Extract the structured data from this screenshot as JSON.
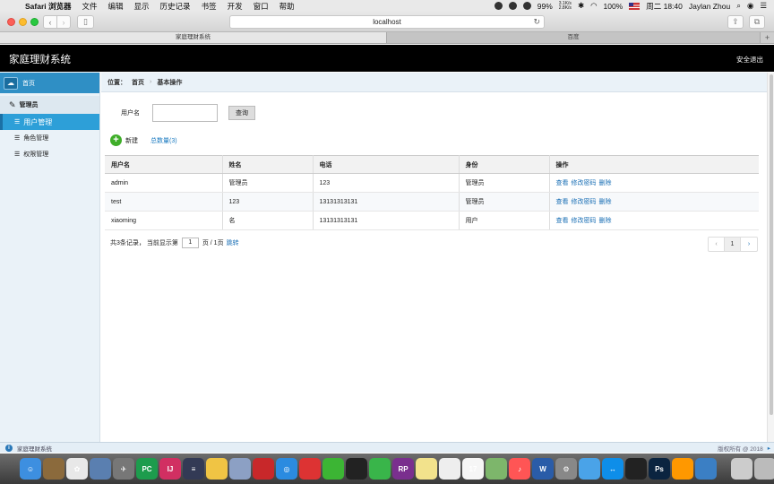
{
  "menubar": {
    "app_name": "Safari 浏览器",
    "items": [
      "文件",
      "编辑",
      "显示",
      "历史记录",
      "书签",
      "开发",
      "窗口",
      "帮助"
    ],
    "net_up": "3.1K/s",
    "net_down": "2.8K/s",
    "battery": "99%",
    "battery2": "100%",
    "clock": "周二 18:40",
    "user": "Jaylan Zhou"
  },
  "browser": {
    "address": "localhost",
    "tabs": [
      "家庭理财系统",
      "百度"
    ],
    "new_tab": "+"
  },
  "header": {
    "title": "家庭理财系统",
    "logout": "安全退出"
  },
  "sidebar": {
    "home": "首页",
    "group": "管理员",
    "items": [
      {
        "label": "用户管理",
        "active": true
      },
      {
        "label": "角色管理",
        "active": false
      },
      {
        "label": "权限管理",
        "active": false
      }
    ]
  },
  "breadcrumb": {
    "prefix": "位置：",
    "home": "首页",
    "sep": "›",
    "current": "基本操作"
  },
  "search": {
    "label": "用户名",
    "value": "",
    "button": "查询"
  },
  "actions": {
    "new": "新建",
    "total": "总数量(3)"
  },
  "table": {
    "headers": [
      "用户名",
      "姓名",
      "电话",
      "身份",
      "操作"
    ],
    "rows": [
      {
        "username": "admin",
        "name": "管理员",
        "phone": "123",
        "role": "管理员"
      },
      {
        "username": "test",
        "name": "123",
        "phone": "13131313131",
        "role": "管理员"
      },
      {
        "username": "xiaoming",
        "name": "名",
        "phone": "13131313131",
        "role": "用户"
      }
    ],
    "ops": [
      "查看",
      "修改密码",
      "删除"
    ]
  },
  "pager": {
    "summary": "共3条记录，  当前显示第",
    "page": "1",
    "of_pages": "页 / 1页",
    "jump": "跳转",
    "prev": "‹",
    "current": "1",
    "next": "›"
  },
  "statusbar": {
    "text": "家庭理财系统",
    "copyright": "版权所有 @ 2018"
  },
  "dock": [
    {
      "name": "finder",
      "color": "#3d8fe0",
      "glyph": "☺"
    },
    {
      "name": "notes-app",
      "color": "#8b6a3c",
      "glyph": ""
    },
    {
      "name": "photos",
      "color": "#e8e8e8",
      "glyph": "✿"
    },
    {
      "name": "preview",
      "color": "#5a7fb0",
      "glyph": ""
    },
    {
      "name": "launchpad",
      "color": "#777",
      "glyph": "✈"
    },
    {
      "name": "pycharm",
      "color": "#1d9c4d",
      "glyph": "PC"
    },
    {
      "name": "intellij",
      "color": "#d12f62",
      "glyph": "IJ"
    },
    {
      "name": "sublime",
      "color": "#333a55",
      "glyph": "≡"
    },
    {
      "name": "cyberduck",
      "color": "#f0c444",
      "glyph": ""
    },
    {
      "name": "database",
      "color": "#8ca0c4",
      "glyph": ""
    },
    {
      "name": "redis",
      "color": "#c8282a",
      "glyph": ""
    },
    {
      "name": "safari",
      "color": "#2b8be0",
      "glyph": "◎"
    },
    {
      "name": "redacted",
      "color": "#d33",
      "glyph": ""
    },
    {
      "name": "wechat",
      "color": "#3cb534",
      "glyph": ""
    },
    {
      "name": "qq",
      "color": "#222",
      "glyph": ""
    },
    {
      "name": "qq-music",
      "color": "#39b54a",
      "glyph": ""
    },
    {
      "name": "axure",
      "color": "#7a2f8e",
      "glyph": "RP"
    },
    {
      "name": "stickies",
      "color": "#f2e28c",
      "glyph": ""
    },
    {
      "name": "reminders",
      "color": "#eee",
      "glyph": ""
    },
    {
      "name": "calendar",
      "color": "#f6f6f6",
      "glyph": "17"
    },
    {
      "name": "maps",
      "color": "#7db66b",
      "glyph": ""
    },
    {
      "name": "music",
      "color": "#f55",
      "glyph": "♪"
    },
    {
      "name": "word",
      "color": "#2a5ca8",
      "glyph": "W"
    },
    {
      "name": "system-preferences",
      "color": "#888",
      "glyph": "⚙"
    },
    {
      "name": "baidu-netdisk",
      "color": "#4aa3e8",
      "glyph": ""
    },
    {
      "name": "teamviewer",
      "color": "#0e8ee9",
      "glyph": "↔"
    },
    {
      "name": "qq-2",
      "color": "#222",
      "glyph": ""
    },
    {
      "name": "photoshop",
      "color": "#0b2440",
      "glyph": "Ps"
    },
    {
      "name": "sublime-2",
      "color": "#ff9800",
      "glyph": ""
    },
    {
      "name": "browser",
      "color": "#3b7fc4",
      "glyph": ""
    },
    {
      "name": "documents",
      "color": "#ccc",
      "glyph": ""
    },
    {
      "name": "trash",
      "color": "#bbb",
      "glyph": ""
    }
  ]
}
